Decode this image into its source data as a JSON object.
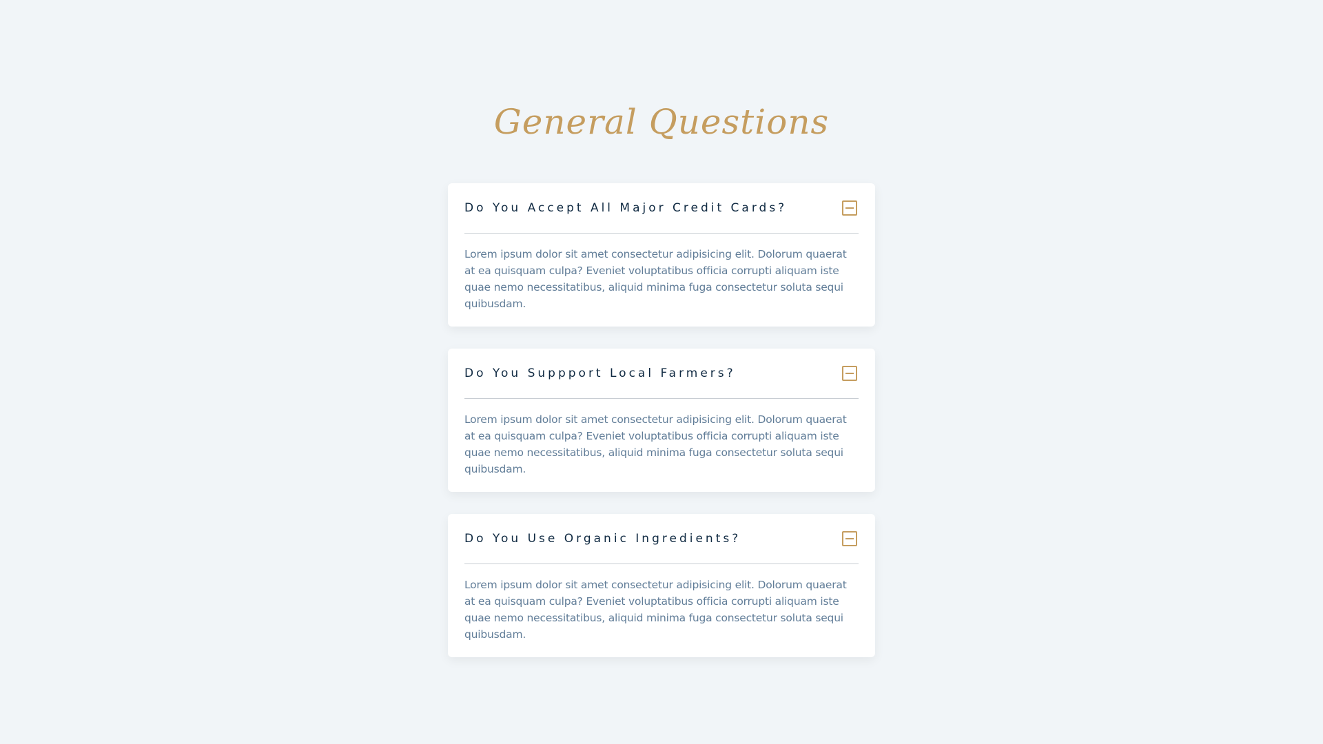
{
  "section": {
    "title": "General Questions"
  },
  "questions": [
    {
      "title": "Do You Accept All Major Credit Cards?",
      "answer": "Lorem ipsum dolor sit amet consectetur adipisicing elit. Dolorum quaerat at ea quisquam culpa? Eveniet voluptatibus officia corrupti aliquam iste quae nemo necessitatibus, aliquid minima fuga consectetur soluta sequi quibusdam.",
      "toggle_icon": "minus-square-icon"
    },
    {
      "title": "Do You Suppport Local Farmers?",
      "answer": "Lorem ipsum dolor sit amet consectetur adipisicing elit. Dolorum quaerat at ea quisquam culpa? Eveniet voluptatibus officia corrupti aliquam iste quae nemo necessitatibus, aliquid minima fuga consectetur soluta sequi quibusdam.",
      "toggle_icon": "minus-square-icon"
    },
    {
      "title": "Do You Use Organic Ingredients?",
      "answer": "Lorem ipsum dolor sit amet consectetur adipisicing elit. Dolorum quaerat at ea quisquam culpa? Eveniet voluptatibus officia corrupti aliquam iste quae nemo necessitatibus, aliquid minima fuga consectetur soluta sequi quibusdam.",
      "toggle_icon": "minus-square-icon"
    }
  ],
  "colors": {
    "background": "#f1f5f8",
    "accent": "#c59d5f",
    "heading": "#102a42",
    "body_text": "#617d98",
    "card": "#ffffff"
  }
}
